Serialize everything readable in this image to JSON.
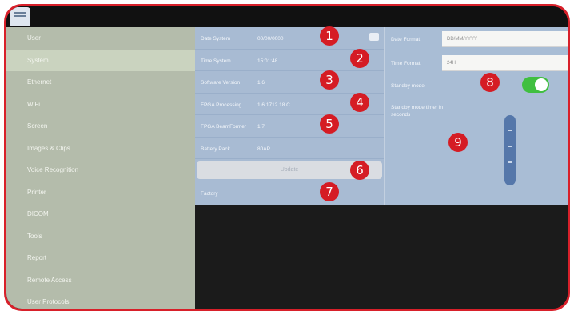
{
  "sidebar": {
    "items": [
      {
        "label": "User"
      },
      {
        "label": "System",
        "selected": true
      },
      {
        "label": "Ethernet"
      },
      {
        "label": "WiFi"
      },
      {
        "label": "Screen"
      },
      {
        "label": "Images & Clips"
      },
      {
        "label": "Voice Recognition"
      },
      {
        "label": "Printer"
      },
      {
        "label": "DICOM"
      },
      {
        "label": "Tools"
      },
      {
        "label": "Report"
      },
      {
        "label": "Remote Access"
      },
      {
        "label": "User Protocols"
      }
    ]
  },
  "system": {
    "date": {
      "label": "Date System",
      "value": "00/00/0000"
    },
    "time": {
      "label": "Time System",
      "value": "15:01:48"
    },
    "software": {
      "label": "Software Version",
      "value": "1.6"
    },
    "fpga_processing": {
      "label": "FPGA Processing",
      "value": "1.6.1712.18.C"
    },
    "fpga_beamformer": {
      "label": "FPGA BeamFormer",
      "value": "1.7"
    },
    "battery": {
      "label": "Battery Pack",
      "value": "80AP"
    },
    "update_label": "Update",
    "factory_label": "Factory"
  },
  "settings": {
    "date_format": {
      "label": "Date Format",
      "value": "DD/MM/YYYY"
    },
    "time_format": {
      "label": "Time Format",
      "value": "24H"
    },
    "standby_mode_label": "Standby mode",
    "standby_mode_on": true,
    "standby_time_label": "Standby mode timer in seconds"
  },
  "callouts": [
    "1",
    "2",
    "3",
    "4",
    "5",
    "6",
    "7",
    "8",
    "9"
  ],
  "colors": {
    "frame": "#d8202a",
    "badge": "#d51c24",
    "toggle_on": "#40bf40",
    "sidebar": "#b4bcab",
    "panel": "#a8bbd3"
  },
  "icons": {
    "calendar": "calendar-icon",
    "logo": "app-logo-icon"
  }
}
